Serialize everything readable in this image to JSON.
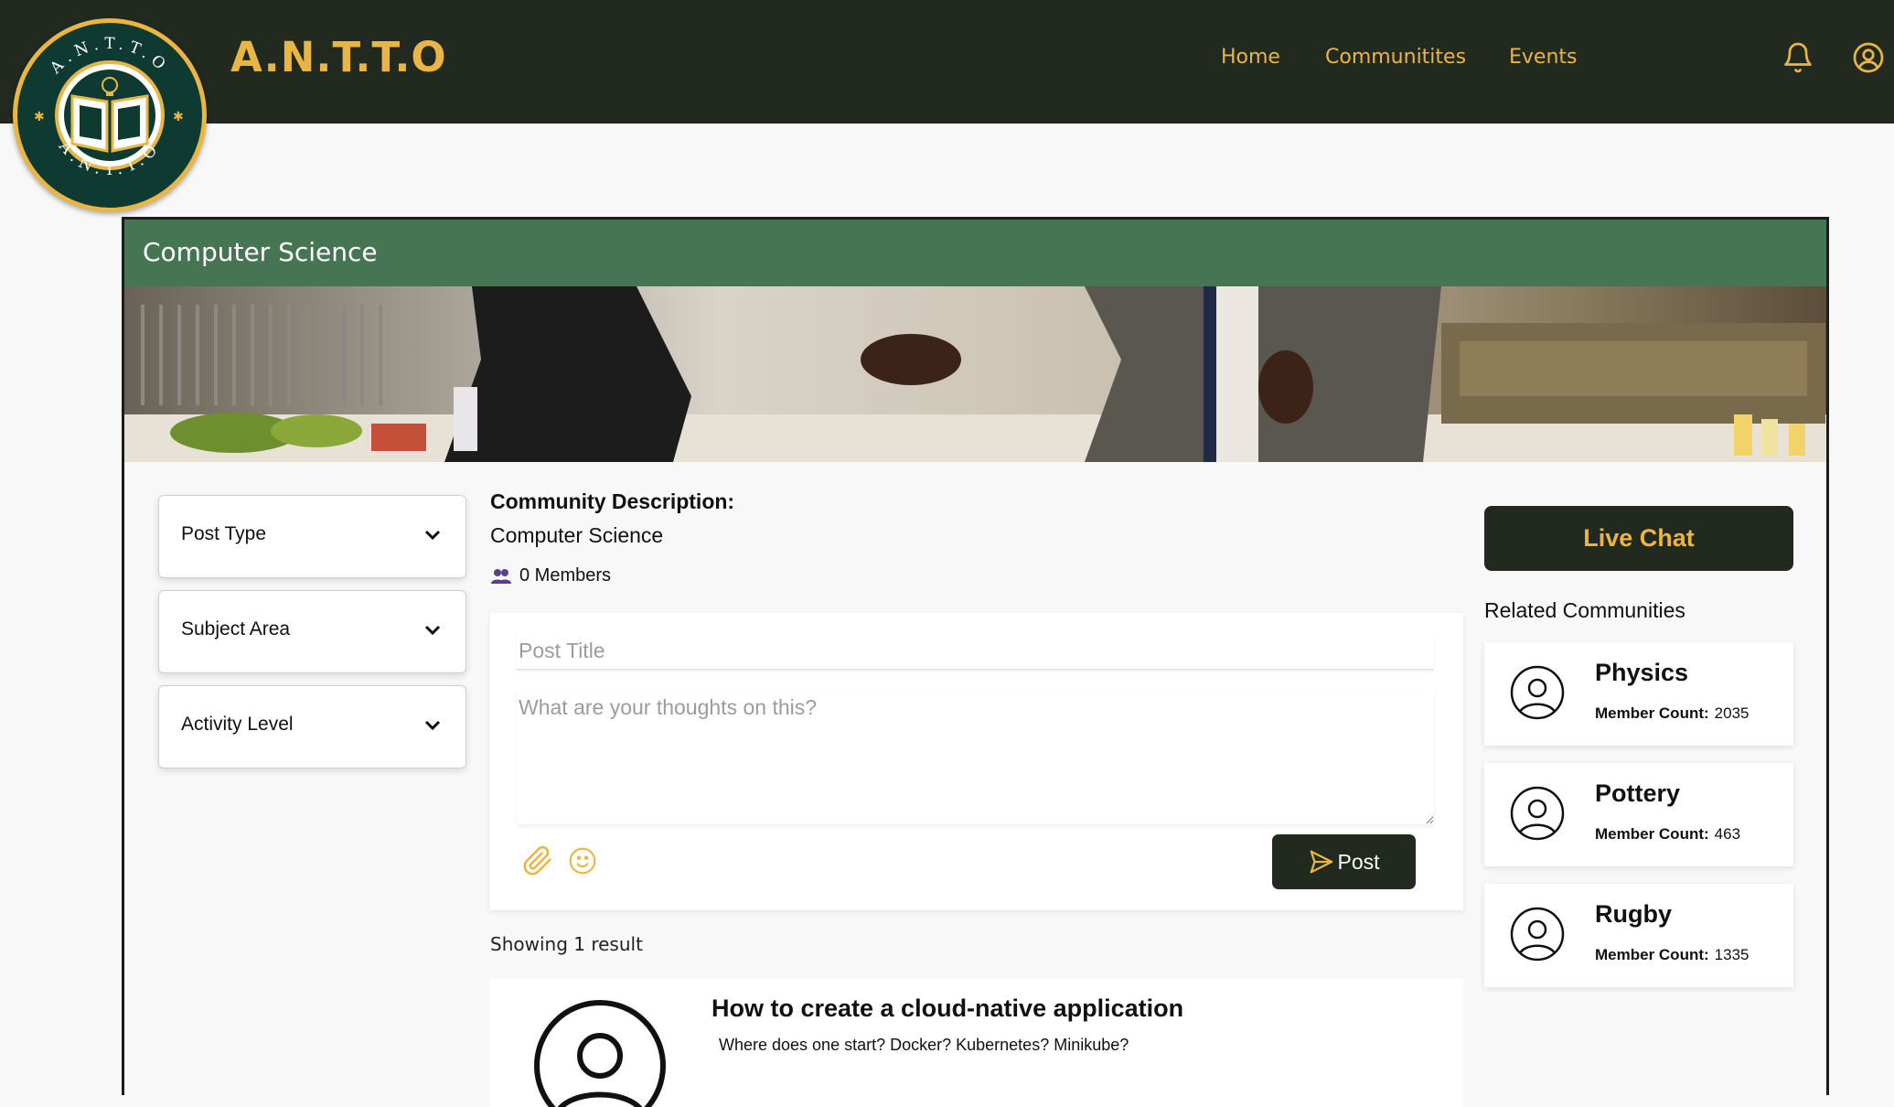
{
  "app": {
    "brand": "A.N.T.T.O",
    "logo_text": "A.N.T.T.O"
  },
  "nav": {
    "home": "Home",
    "communities": "Communitites",
    "events": "Events"
  },
  "icons": {
    "notifications": "bell-icon",
    "account": "user-circle-icon"
  },
  "community": {
    "header_title": "Computer Science",
    "description_label": "Community Description:",
    "description": "Computer Science",
    "members": "0 Members"
  },
  "filters": [
    {
      "label": "Post Type"
    },
    {
      "label": "Subject Area"
    },
    {
      "label": "Activity Level"
    }
  ],
  "composer": {
    "title_placeholder": "Post Title",
    "body_placeholder": "What are your thoughts on this?",
    "post_label": "Post"
  },
  "results": {
    "summary": "Showing 1 result"
  },
  "posts": [
    {
      "title": "How to create a cloud-native application",
      "body": "Where does one start? Docker? Kubernetes? Minikube?"
    }
  ],
  "sidebar": {
    "live_chat": "Live Chat",
    "related_title": "Related Communities",
    "count_label": "Member Count:",
    "related": [
      {
        "name": "Physics",
        "count": "2035"
      },
      {
        "name": "Pottery",
        "count": "463"
      },
      {
        "name": "Rugby",
        "count": "1335"
      }
    ]
  },
  "colors": {
    "topbar": "#22291f",
    "accent_gold": "#e9b545",
    "header_green": "#467554",
    "button_dark": "#22291f"
  }
}
